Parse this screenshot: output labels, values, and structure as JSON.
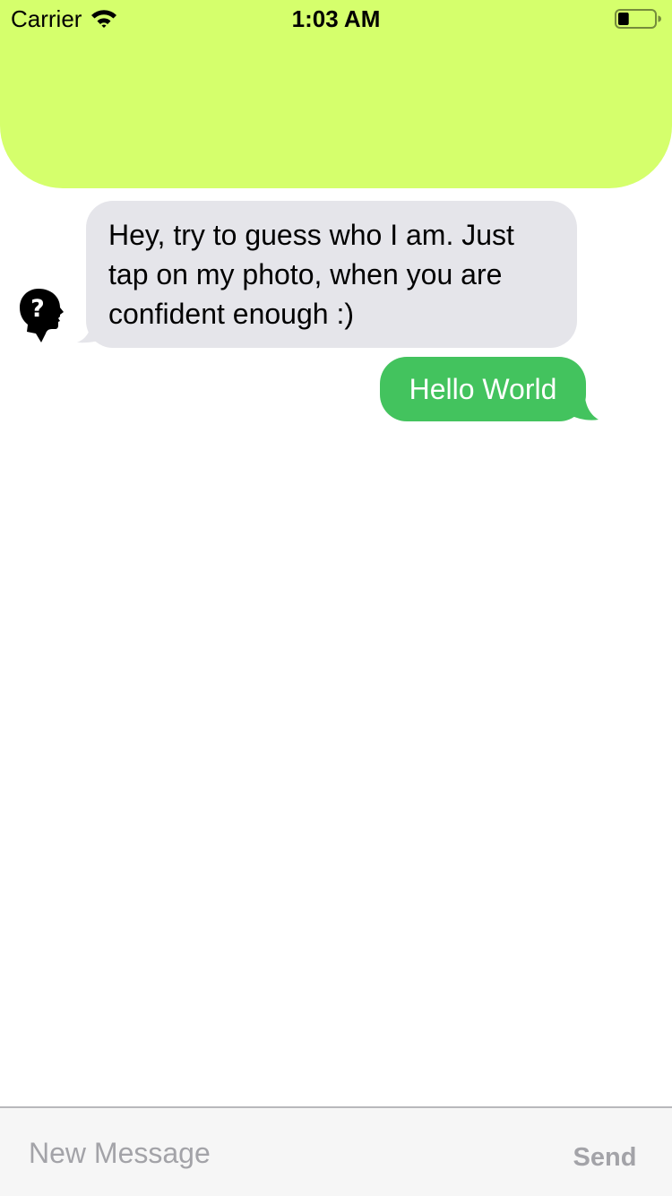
{
  "status_bar": {
    "carrier": "Carrier",
    "time": "1:03 AM",
    "wifi_icon": "wifi-icon",
    "battery_icon": "battery-icon",
    "battery_level": 0.3
  },
  "colors": {
    "header": "#d5ff6c",
    "incoming_bubble": "#e5e5ea",
    "outgoing_bubble": "#43c35e",
    "input_bar": "#f6f6f6",
    "send_text": "#a3a3a8"
  },
  "chat": {
    "avatar_icon": "mystery-person-question-icon",
    "incoming_message": "Hey, try to guess who I am. Just tap on my photo, when you are confident enough :)",
    "outgoing_message": "Hello World"
  },
  "input_bar": {
    "placeholder": "New Message",
    "value": "",
    "send_label": "Send"
  }
}
